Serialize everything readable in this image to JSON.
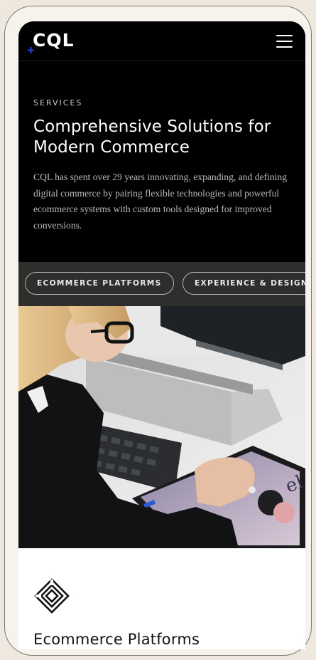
{
  "header": {
    "logo_text": "CQL",
    "menu_icon": "hamburger-icon",
    "accent_color": "#1e4cff"
  },
  "hero": {
    "eyebrow": "SERVICES",
    "title": "Comprehensive Solutions for Modern Commerce",
    "description": "CQL has spent over 29 years innovating, expanding, and defining digital commerce by pairing flexible technologies and powerful ecommerce systems with custom tools designed for improved conversions."
  },
  "tabs": [
    {
      "label": "ECOMMERCE PLATFORMS"
    },
    {
      "label": "EXPERIENCE & DESIGN"
    }
  ],
  "section": {
    "icon": "layers-diamond-icon",
    "title": "Ecommerce Platforms"
  },
  "colors": {
    "hero_bg": "#000000",
    "tabs_bg": "#2e2e2c",
    "content_bg": "#ffffff"
  }
}
